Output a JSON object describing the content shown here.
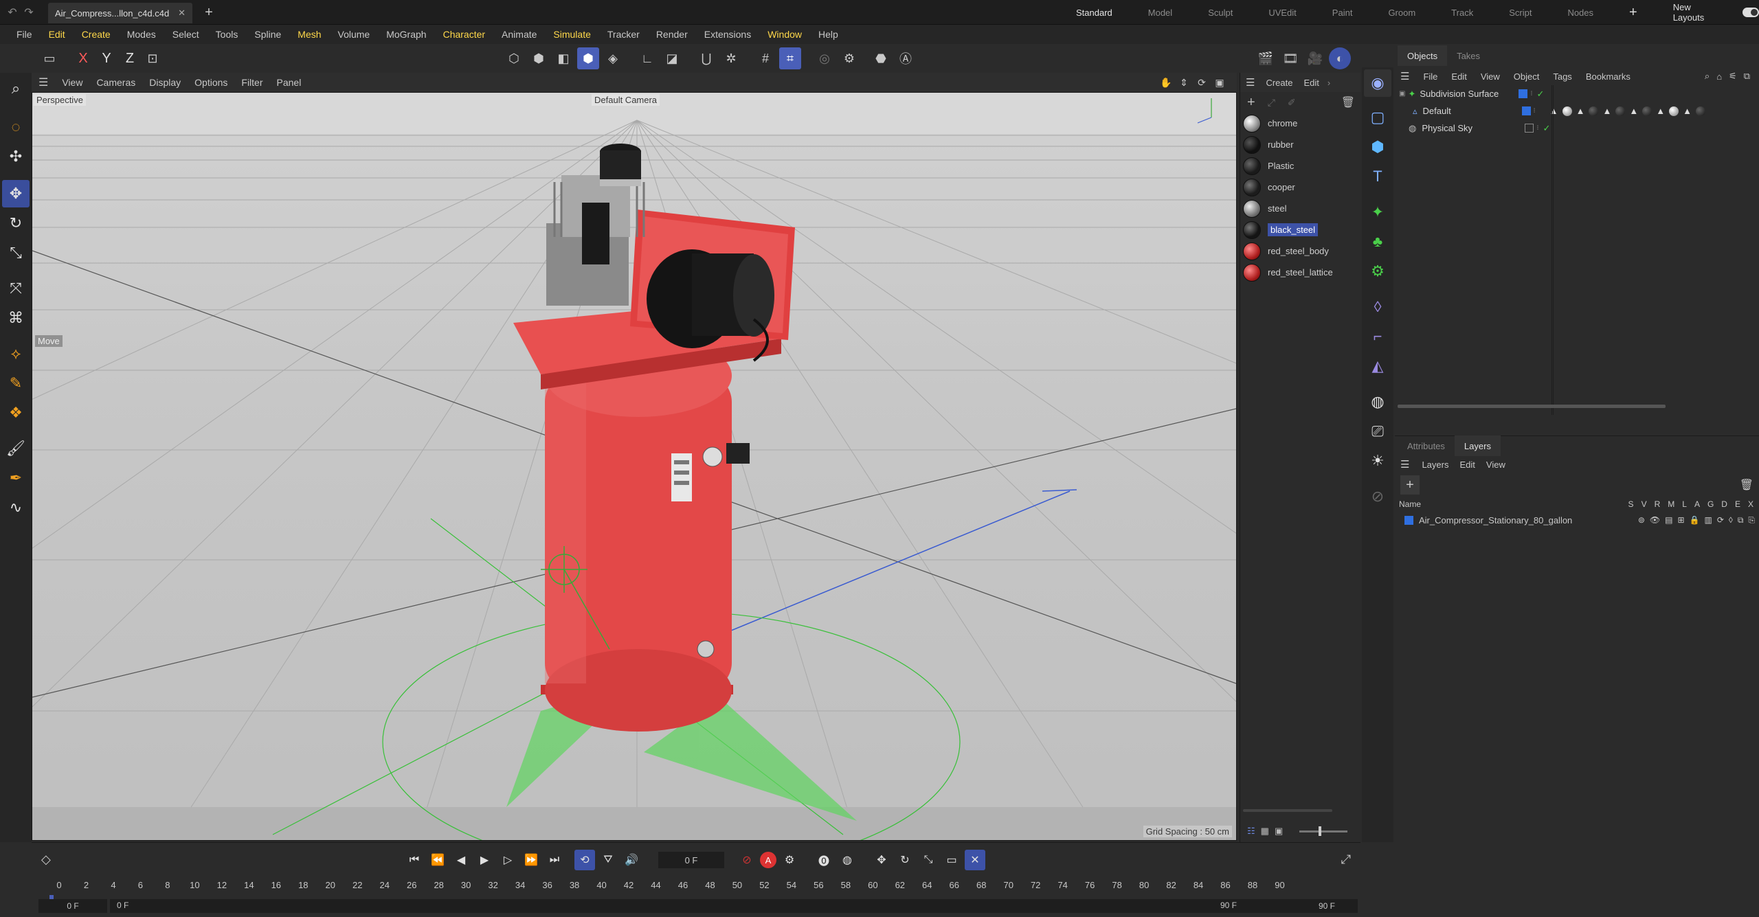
{
  "titlebar": {
    "doc_tab": "Air_Compress...llon_c4d.c4d",
    "layouts": [
      "Standard",
      "Model",
      "Sculpt",
      "UVEdit",
      "Paint",
      "Groom",
      "Track",
      "Script",
      "Nodes"
    ],
    "active_layout": "Standard",
    "new_layouts": "New Layouts"
  },
  "menubar": {
    "items": [
      "File",
      "Edit",
      "Create",
      "Modes",
      "Select",
      "Tools",
      "Spline",
      "Mesh",
      "Volume",
      "MoGraph",
      "Character",
      "Animate",
      "Simulate",
      "Tracker",
      "Render",
      "Extensions",
      "Window",
      "Help"
    ],
    "highlighted": [
      "Edit",
      "Create",
      "Mesh",
      "Character",
      "Simulate",
      "Window"
    ]
  },
  "toolbar": {
    "axes": [
      "X",
      "Y",
      "Z"
    ]
  },
  "viewport": {
    "menus": [
      "View",
      "Cameras",
      "Display",
      "Options",
      "Filter",
      "Panel"
    ],
    "projection": "Perspective",
    "camera": "Default Camera",
    "move_hint": "Move",
    "grid_spacing": "Grid Spacing : 50 cm"
  },
  "materials": {
    "menus": [
      "Create",
      "Edit"
    ],
    "items": [
      {
        "name": "chrome",
        "color": "#bfbfbf"
      },
      {
        "name": "rubber",
        "color": "#1a1a1a"
      },
      {
        "name": "Plastic",
        "color": "#222222"
      },
      {
        "name": "cooper",
        "color": "#262626"
      },
      {
        "name": "steel",
        "color": "#9a9a9a"
      },
      {
        "name": "black_steel",
        "color": "#202020"
      },
      {
        "name": "red_steel_body",
        "color": "#c42c2c"
      },
      {
        "name": "red_steel_lattice",
        "color": "#c42c2c"
      }
    ],
    "selected": "black_steel"
  },
  "objects": {
    "tabs": [
      "Objects",
      "Takes"
    ],
    "menus": [
      "File",
      "Edit",
      "View",
      "Object",
      "Tags",
      "Bookmarks"
    ],
    "tree": [
      {
        "name": "Subdivision Surface",
        "indent": 0
      },
      {
        "name": "Default",
        "indent": 1
      },
      {
        "name": "Physical Sky",
        "indent": 0
      }
    ]
  },
  "layers": {
    "tabs": [
      "Attributes",
      "Layers"
    ],
    "active_tab": "Layers",
    "menus": [
      "Layers",
      "Edit",
      "View"
    ],
    "columns_label": "Name",
    "flags": [
      "S",
      "V",
      "R",
      "M",
      "L",
      "A",
      "G",
      "D",
      "E",
      "X"
    ],
    "rows": [
      "Air_Compressor_Stationary_80_gallon"
    ]
  },
  "timeline": {
    "ticks": [
      "0",
      "2",
      "4",
      "6",
      "8",
      "10",
      "12",
      "14",
      "16",
      "18",
      "20",
      "22",
      "24",
      "26",
      "28",
      "30",
      "32",
      "34",
      "36",
      "38",
      "40",
      "42",
      "44",
      "46",
      "48",
      "50",
      "52",
      "54",
      "56",
      "58",
      "60",
      "62",
      "64",
      "66",
      "68",
      "70",
      "72",
      "74",
      "76",
      "78",
      "80",
      "82",
      "84",
      "86",
      "88",
      "90"
    ],
    "current_frame": "0 F",
    "start_frame": "0 F",
    "start_range": "0 F",
    "end_range": "90 F",
    "end_frame": "90 F"
  },
  "colors": {
    "accent": "#3d52a8",
    "highlight_menu": "#ffd84a",
    "compressor_red": "#e03a3a"
  }
}
